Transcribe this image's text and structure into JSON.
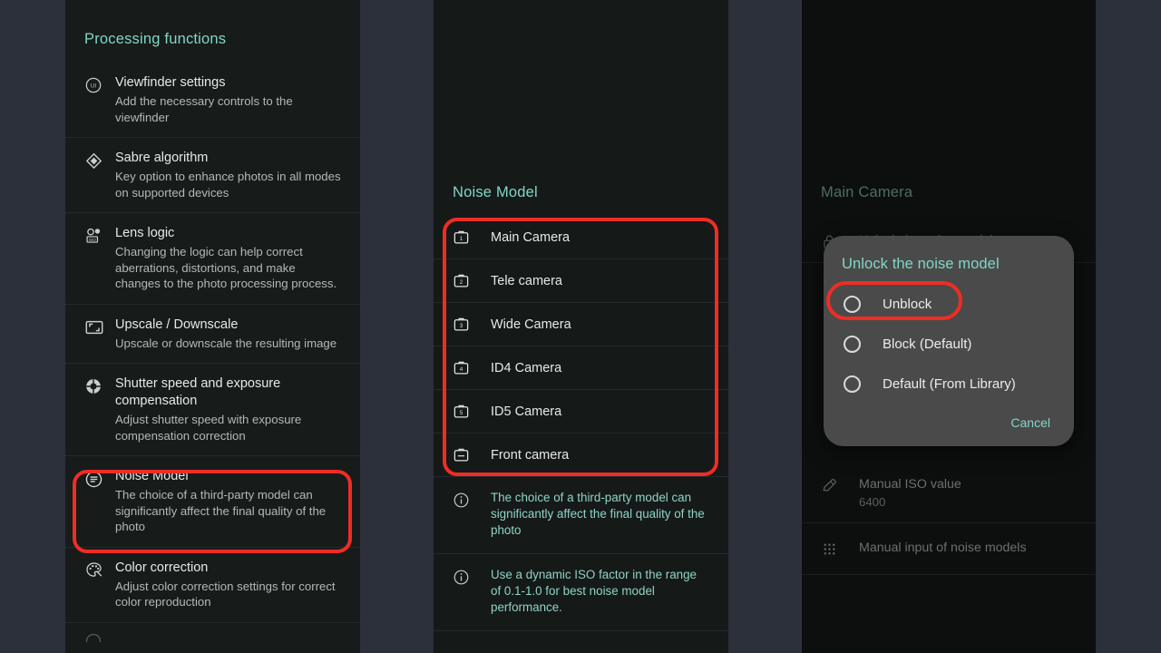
{
  "background_color": "#2b303b",
  "accent_color": "#82d6c6",
  "highlight_color": "#ee2d24",
  "panels": {
    "processing": {
      "title": "Processing functions",
      "items": [
        {
          "icon": "viewfinder-ui-icon",
          "title": "Viewfinder settings",
          "subtitle": "Add the necessary controls to the viewfinder"
        },
        {
          "icon": "diamond-icon",
          "title": "Sabre algorithm",
          "subtitle": "Key option to enhance photos in all modes on supported devices"
        },
        {
          "icon": "lens-iso-icon",
          "title": "Lens logic",
          "subtitle": "Changing the logic can help correct aberrations, distortions, and make changes to the photo processing process."
        },
        {
          "icon": "scale-icon",
          "title": "Upscale / Downscale",
          "subtitle": "Upscale or downscale the resulting image"
        },
        {
          "icon": "aperture-icon",
          "title": "Shutter speed and exposure compensation",
          "subtitle": "Adjust shutter speed with exposure compensation correction"
        },
        {
          "icon": "noise-model-icon",
          "title": "Noise Model",
          "subtitle": "The choice of a third-party model can significantly affect the final quality of the photo"
        },
        {
          "icon": "palette-icon",
          "title": "Color correction",
          "subtitle": "Adjust color correction settings for correct color reproduction"
        }
      ],
      "highlighted_item": "Noise Model"
    },
    "noise_model": {
      "title": "Noise Model",
      "cameras": [
        {
          "icon": "camera-1-icon",
          "label": "Main Camera"
        },
        {
          "icon": "camera-2-icon",
          "label": "Tele camera"
        },
        {
          "icon": "camera-3-icon",
          "label": "Wide Camera"
        },
        {
          "icon": "camera-4-icon",
          "label": "ID4 Camera"
        },
        {
          "icon": "camera-5-icon",
          "label": "ID5 Camera"
        },
        {
          "icon": "camera-front-icon",
          "label": "Front camera"
        }
      ],
      "notes": [
        {
          "icon": "info-icon",
          "text": "The choice of a third-party model can significantly affect the final quality of the photo"
        },
        {
          "icon": "info-icon",
          "text": "Use a dynamic ISO factor in the range of 0.1-1.0 for best noise model performance."
        }
      ]
    },
    "main_camera": {
      "title": "Main Camera",
      "obscured_row": {
        "icon": "lock-icon",
        "title": "Unlock the noise model"
      },
      "rows": [
        {
          "icon": "pencil-icon",
          "title": "Manual ISO value",
          "subtitle": "6400"
        },
        {
          "icon": "grid-dots-icon",
          "title": "Manual input of noise models",
          "subtitle": ""
        }
      ]
    }
  },
  "dialog": {
    "title": "Unlock the noise model",
    "options": [
      {
        "label": "Unblock",
        "selected": false,
        "highlighted": true
      },
      {
        "label": "Block (Default)",
        "selected": false,
        "highlighted": false
      },
      {
        "label": "Default (From Library)",
        "selected": false,
        "highlighted": false
      }
    ],
    "cancel_label": "Cancel"
  }
}
